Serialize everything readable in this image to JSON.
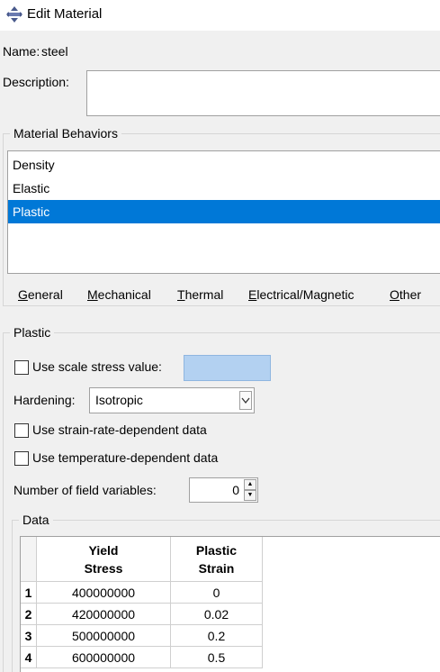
{
  "window": {
    "title": "Edit Material"
  },
  "name": {
    "label": "Name:",
    "value": "steel"
  },
  "description": {
    "label": "Description:",
    "value": ""
  },
  "behaviors": {
    "title": "Material Behaviors",
    "items": [
      {
        "label": "Density",
        "selected": false
      },
      {
        "label": "Elastic",
        "selected": false
      },
      {
        "label": "Plastic",
        "selected": true
      }
    ]
  },
  "menu": {
    "general": {
      "u": "G",
      "rest": "eneral"
    },
    "mechanical": {
      "u": "M",
      "rest": "echanical"
    },
    "thermal": {
      "u": "T",
      "rest": "hermal"
    },
    "electrical": {
      "u": "E",
      "rest": "lectrical/Magnetic"
    },
    "other": {
      "u": "O",
      "rest": "ther"
    }
  },
  "plastic": {
    "title": "Plastic",
    "scale_stress_label": "Use scale stress value:",
    "scale_stress_value": "",
    "hardening_label": "Hardening:",
    "hardening_value": "Isotropic",
    "strain_rate_label": "Use strain-rate-dependent data",
    "temperature_label": "Use temperature-dependent data",
    "field_vars_label": "Number of field variables:",
    "field_vars_value": "0"
  },
  "data": {
    "title": "Data",
    "columns": [
      {
        "line1": "Yield",
        "line2": "Stress"
      },
      {
        "line1": "Plastic",
        "line2": "Strain"
      }
    ],
    "rows": [
      {
        "num": "1",
        "yield_stress": "400000000",
        "plastic_strain": "0"
      },
      {
        "num": "2",
        "yield_stress": "420000000",
        "plastic_strain": "0.02"
      },
      {
        "num": "3",
        "yield_stress": "500000000",
        "plastic_strain": "0.2"
      },
      {
        "num": "4",
        "yield_stress": "600000000",
        "plastic_strain": "0.5"
      }
    ]
  },
  "colors": {
    "selection": "#0078d7",
    "highlight_field": "#b3d1f1",
    "panel": "#f0f0f0"
  }
}
